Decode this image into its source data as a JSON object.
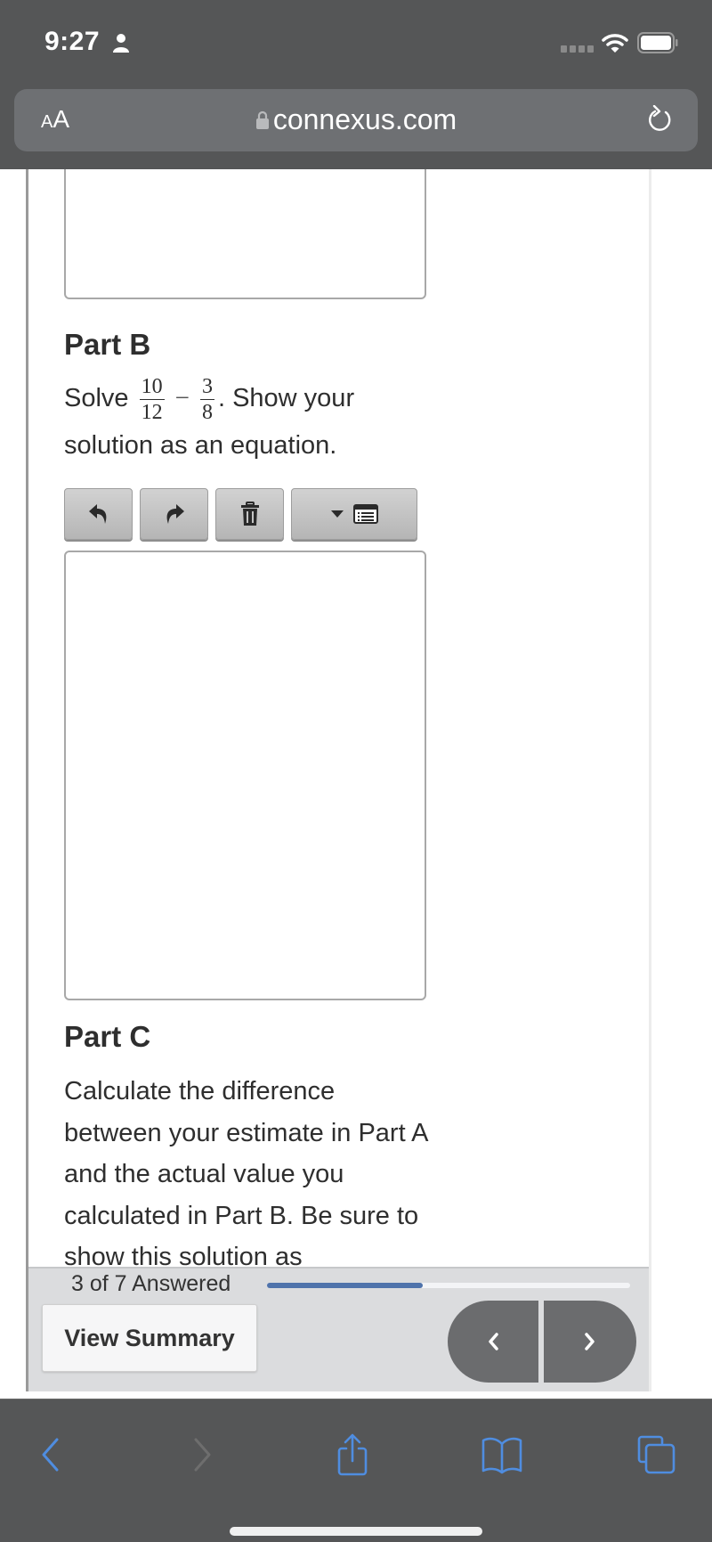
{
  "status_bar": {
    "time": "9:27",
    "icons": [
      "person-icon",
      "cellular-signal-icon",
      "wifi-icon",
      "battery-icon"
    ]
  },
  "browser": {
    "text_size_button": {
      "small": "A",
      "large": "A"
    },
    "url": "connexus.com",
    "icons": [
      "lock-icon",
      "reload-icon"
    ]
  },
  "content": {
    "part_b": {
      "title": "Part B",
      "prefix": "Solve",
      "fraction1": {
        "numerator": "10",
        "denominator": "12"
      },
      "operator": "−",
      "fraction2": {
        "numerator": "3",
        "denominator": "8"
      },
      "suffix": ". Show your solution as an equation."
    },
    "toolbar": {
      "buttons": [
        {
          "name": "undo",
          "icon": "undo-icon"
        },
        {
          "name": "redo",
          "icon": "redo-icon"
        },
        {
          "name": "delete",
          "icon": "trash-icon"
        },
        {
          "name": "insert-menu",
          "icon": "dropdown-list-icon"
        }
      ]
    },
    "part_c": {
      "title": "Part C",
      "text": "Calculate the difference between your estimate in Part A and the actual value you calculated in Part B. Be sure to show this solution as"
    }
  },
  "footer": {
    "answered_label": "3 of 7 Answered",
    "answered": 3,
    "total": 7,
    "progress_fraction": 0.4286,
    "view_summary_label": "View Summary",
    "prev_label": "‹",
    "next_label": "›"
  },
  "bottom_bar": {
    "icons": [
      "back-icon",
      "forward-icon",
      "share-icon",
      "bookmarks-icon",
      "tabs-icon"
    ]
  },
  "colors": {
    "chrome_dark": "#555657",
    "progress_blue": "#4f73ab",
    "safari_blue": "#4f8de0",
    "text": "#2e2e2e"
  }
}
